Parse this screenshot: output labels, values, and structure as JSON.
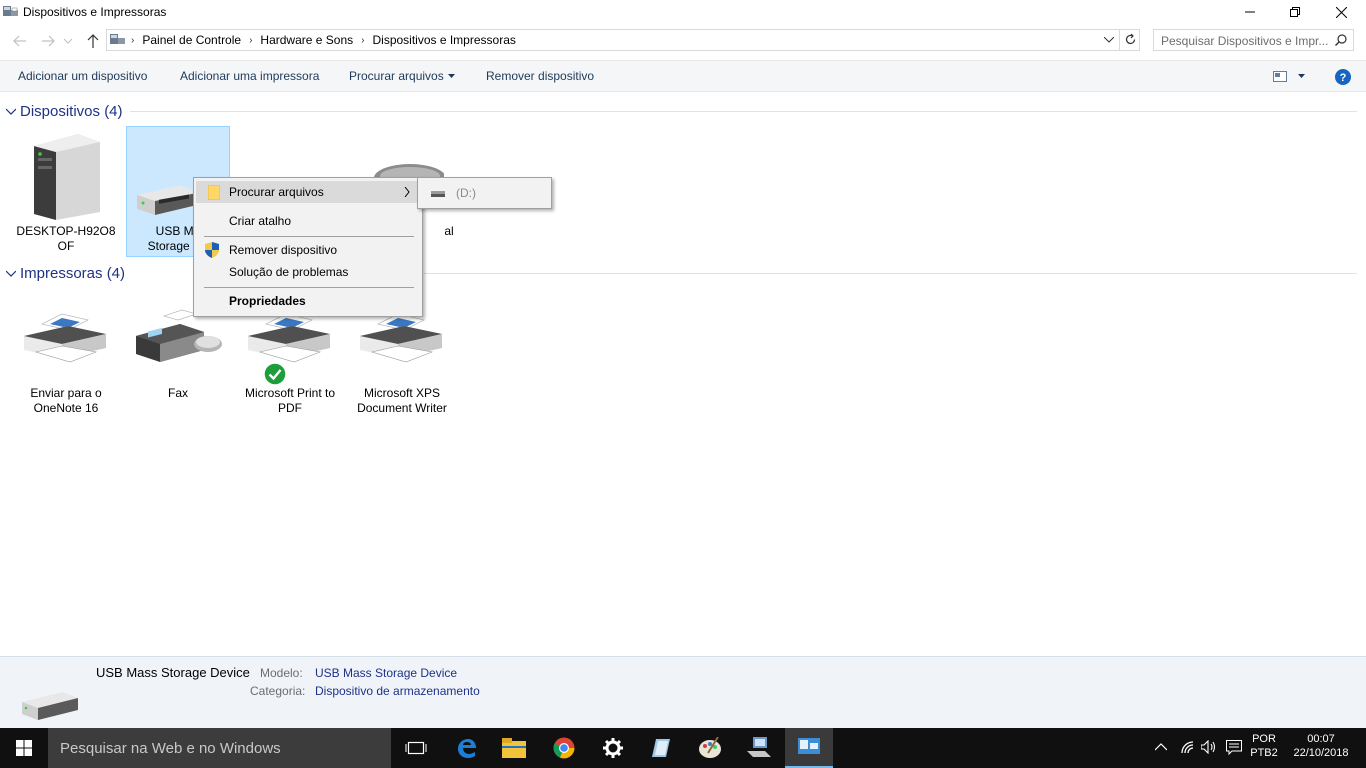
{
  "window": {
    "title": "Dispositivos e Impressoras"
  },
  "address": {
    "crumbs": [
      "Painel de Controle",
      "Hardware e Sons",
      "Dispositivos e Impressoras"
    ],
    "search_placeholder": "Pesquisar Dispositivos e Impr..."
  },
  "commands": {
    "add_device": "Adicionar um dispositivo",
    "add_printer": "Adicionar uma impressora",
    "browse_files": "Procurar arquivos",
    "remove_device": "Remover dispositivo"
  },
  "groups": {
    "devices_title": "Dispositivos (4)",
    "printers_title": "Impressoras (4)"
  },
  "devices": [
    {
      "label1": "DESKTOP-H92O8",
      "label2": "OF"
    },
    {
      "label1": "USB Ma",
      "label2": "Storage De"
    },
    {
      "label1": "al",
      "label2": ""
    }
  ],
  "printers": [
    {
      "label1": "Enviar para o",
      "label2": "OneNote 16"
    },
    {
      "label1": "Fax",
      "label2": ""
    },
    {
      "label1": "Microsoft Print to",
      "label2": "PDF"
    },
    {
      "label1": "Microsoft XPS",
      "label2": "Document Writer"
    }
  ],
  "context_menu": {
    "browse_files": "Procurar arquivos",
    "create_shortcut": "Criar atalho",
    "remove_device": "Remover dispositivo",
    "troubleshoot": "Solução de problemas",
    "properties": "Propriedades",
    "submenu_drive": "(D:)"
  },
  "details": {
    "device_name": "USB Mass Storage Device",
    "model_label": "Modelo:",
    "model_value": "USB Mass Storage Device",
    "category_label": "Categoria:",
    "category_value": "Dispositivo de armazenamento"
  },
  "taskbar": {
    "search_text": "Pesquisar na Web e no Windows",
    "lang1": "POR",
    "lang2": "PTB2",
    "time": "00:07",
    "date": "22/10/2018"
  },
  "colors": {
    "accent": "#1e3287",
    "selection": "#cce8ff",
    "taskbar": "#101010"
  }
}
